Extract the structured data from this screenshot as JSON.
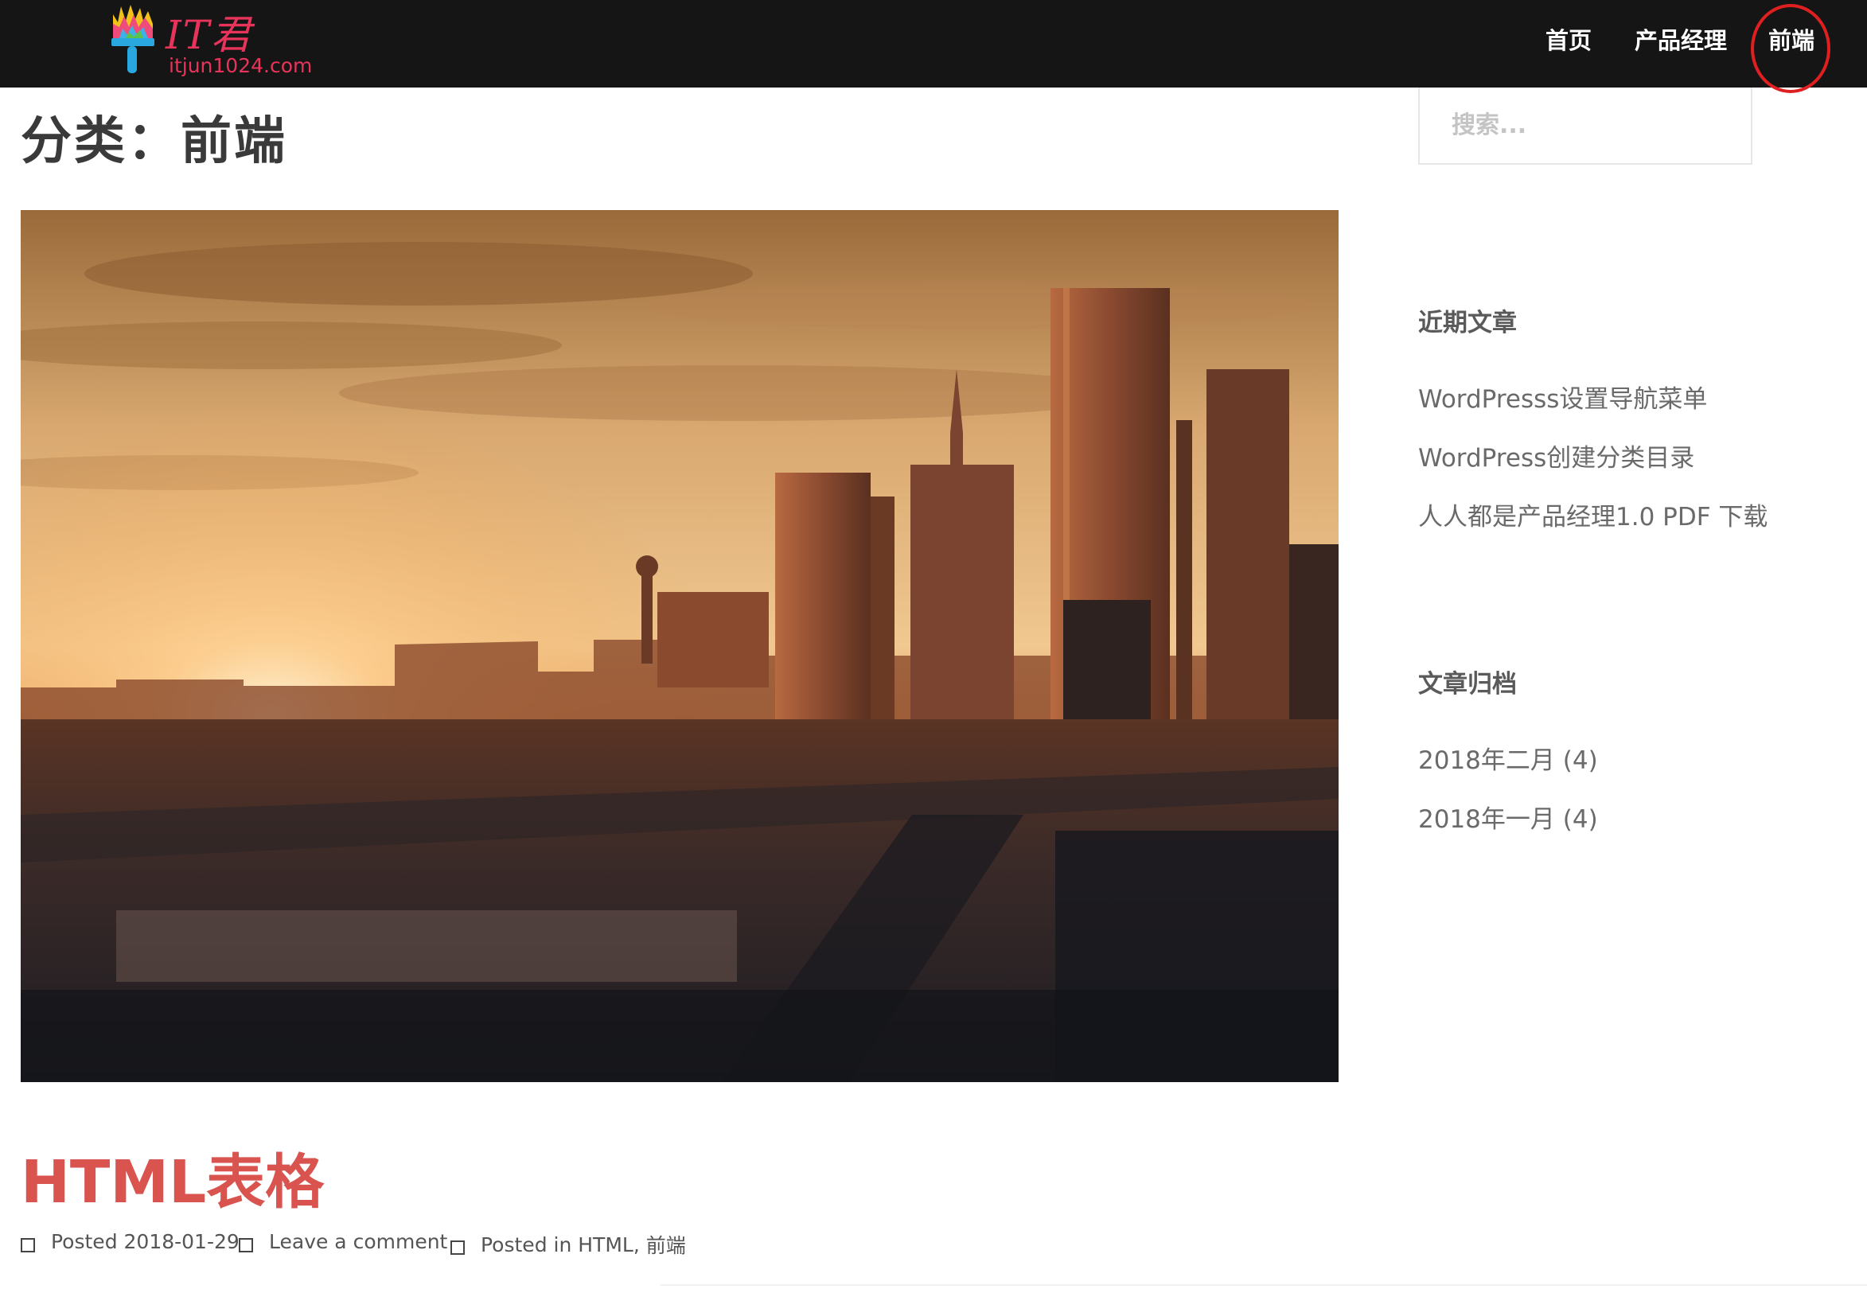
{
  "header": {
    "logo": {
      "title": "IT君",
      "url": "itjun1024.com"
    },
    "nav": [
      {
        "label": "首页"
      },
      {
        "label": "产品经理"
      },
      {
        "label": "前端"
      }
    ]
  },
  "page": {
    "title": "分类：前端"
  },
  "search": {
    "placeholder": "搜索..."
  },
  "post": {
    "title": "HTML表格",
    "meta": {
      "posted": "Posted 2018-01-29",
      "comment": "Leave a comment",
      "posted_in_prefix": "Posted in ",
      "categories": [
        "HTML",
        "前端"
      ]
    }
  },
  "sidebar": {
    "recent": {
      "title": "近期文章",
      "items": [
        "WordPresss设置导航菜单",
        "WordPress创建分类目录",
        "人人都是产品经理1.0 PDF 下载"
      ]
    },
    "archive": {
      "title": "文章归档",
      "items": [
        "2018年二月 (4)",
        "2018年一月 (4)"
      ]
    }
  },
  "colors": {
    "topbar": "#151515",
    "accent": "#d9534f",
    "logo": "#e8345a",
    "highlight_circle": "#e02020"
  },
  "icons": [
    "paintbrush-logo-icon",
    "meta-square-icon"
  ]
}
